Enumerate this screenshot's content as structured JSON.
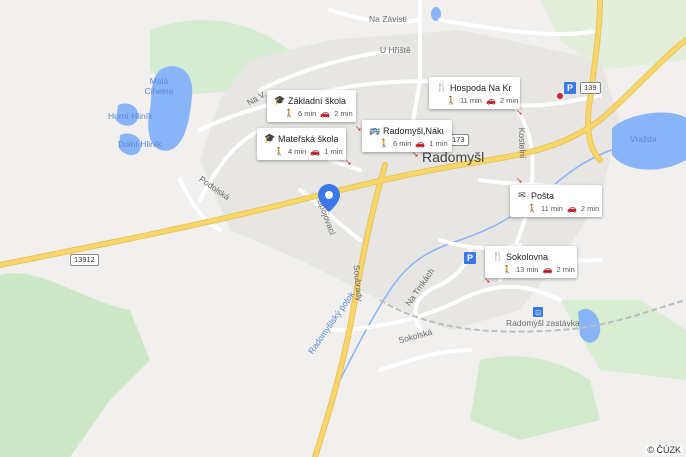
{
  "map": {
    "town_name": "Radomyšl",
    "copyright": "© ČÚZK",
    "street_labels": {
      "na_zavisti": "Na Závisti",
      "u_hriste": "U Hřiště",
      "podolska": "Podolská",
      "spojovaci": "Spojovací",
      "soubrady": "Soubrady",
      "na_trnkach": "Na Trnkách",
      "sokolska": "Sokolská",
      "kostelni": "Kostelní",
      "na_valech": "Na V..."
    },
    "water_labels": {
      "mala_cihelna": "Malá Cihelna",
      "horni_hlinik": "Horní Hliník",
      "dolni_hlinik": "Dolní Hliník",
      "vrazda": "Vražda",
      "stream": "Radomyšlský potok"
    },
    "station_label": "Radomyšl zastávka",
    "road_numbers": {
      "r139": "139",
      "r173": "173",
      "r13912": "13912"
    },
    "parking_label": "P",
    "poi_cards": [
      {
        "title": "Základní škola Ra...",
        "walk": "6 min",
        "drive": "2 min",
        "icon": "school-icon"
      },
      {
        "title": "Mateřská škola R...",
        "walk": "4 min",
        "drive": "1 min",
        "icon": "school-icon"
      },
      {
        "title": "Radomyšl,Nákup....",
        "walk": "6 min",
        "drive": "1 min",
        "icon": "bus-icon"
      },
      {
        "title": "Hospoda Na Kren...",
        "walk": "11 min",
        "drive": "2 min",
        "icon": "restaurant-icon"
      },
      {
        "title": "Pošta",
        "walk": "11 min",
        "drive": "2 min",
        "icon": "post-icon"
      },
      {
        "title": "Sokolovna",
        "walk": "13 min",
        "drive": "2 min",
        "icon": "restaurant-icon"
      }
    ],
    "colors": {
      "background": "#f1f0ee",
      "forest": "#cde8c6",
      "water": "#8ab4f8",
      "major_road": "#f7d66c",
      "pin": "#3b78e7"
    }
  }
}
